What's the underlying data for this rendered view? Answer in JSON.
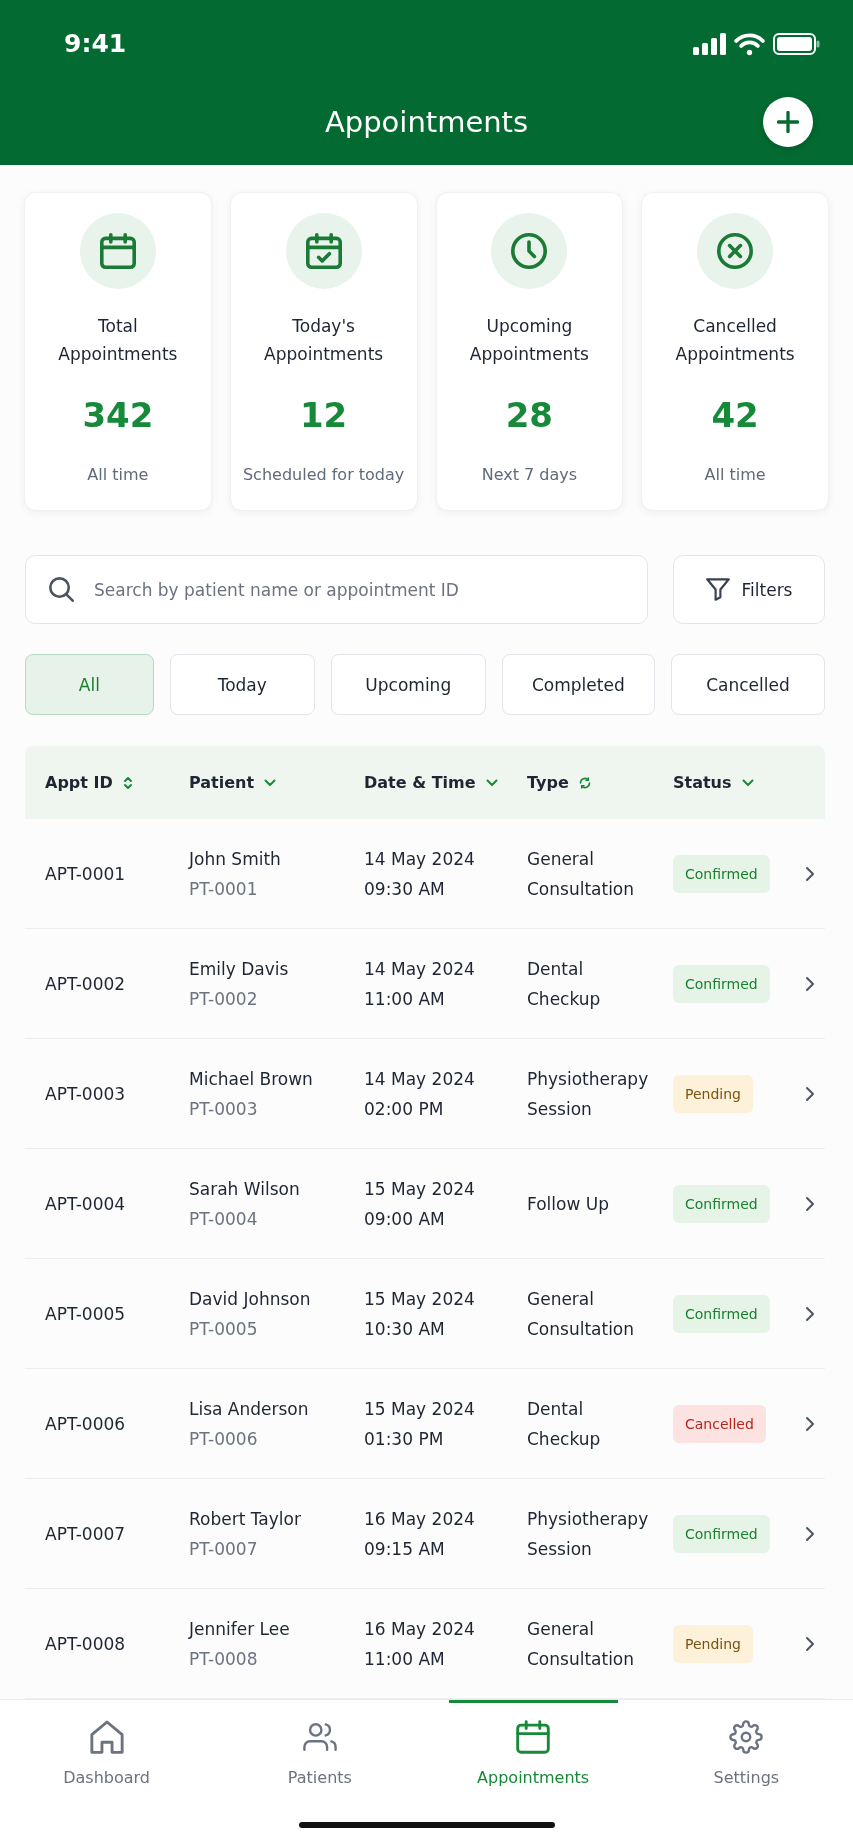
{
  "status_bar": {
    "time": "9:41"
  },
  "header": {
    "title": "Appointments"
  },
  "stats": [
    {
      "label": "Total Appointments",
      "value": "342",
      "caption": "All time"
    },
    {
      "label": "Today's Appointments",
      "value": "12",
      "caption": "Scheduled for today"
    },
    {
      "label": "Upcoming Appointments",
      "value": "28",
      "caption": "Next 7 days"
    },
    {
      "label": "Cancelled Appointments",
      "value": "42",
      "caption": "All time"
    }
  ],
  "search": {
    "placeholder": "Search by patient name or appointment ID"
  },
  "filters_button": {
    "label": "Filters"
  },
  "tabs": [
    {
      "label": "All",
      "selected": true
    },
    {
      "label": "Today",
      "selected": false
    },
    {
      "label": "Upcoming",
      "selected": false
    },
    {
      "label": "Completed",
      "selected": false
    },
    {
      "label": "Cancelled",
      "selected": false
    }
  ],
  "table": {
    "columns": [
      {
        "label": "Appt ID",
        "kind": "updown"
      },
      {
        "label": "Patient",
        "kind": "down"
      },
      {
        "label": "Date & Time",
        "kind": "down"
      },
      {
        "label": "Type",
        "kind": "cycle"
      },
      {
        "label": "Status",
        "kind": "down"
      }
    ],
    "rows": [
      {
        "id": "APT-0001",
        "patient": "John Smith",
        "patient_id": "PT-0001",
        "date": "14 May 2024",
        "time": "09:30 AM",
        "type": "General Consultation",
        "status": {
          "label": "Confirmed",
          "kind": "confirmed"
        }
      },
      {
        "id": "APT-0002",
        "patient": "Emily Davis",
        "patient_id": "PT-0002",
        "date": "14 May 2024",
        "time": "11:00 AM",
        "type": "Dental Checkup",
        "status": {
          "label": "Confirmed",
          "kind": "confirmed"
        }
      },
      {
        "id": "APT-0003",
        "patient": "Michael Brown",
        "patient_id": "PT-0003",
        "date": "14 May 2024",
        "time": "02:00 PM",
        "type": "Physiotherapy Session",
        "status": {
          "label": "Pending",
          "kind": "pending"
        }
      },
      {
        "id": "APT-0004",
        "patient": "Sarah Wilson",
        "patient_id": "PT-0004",
        "date": "15 May 2024",
        "time": "09:00 AM",
        "type": "Follow Up",
        "status": {
          "label": "Confirmed",
          "kind": "confirmed"
        }
      },
      {
        "id": "APT-0005",
        "patient": "David Johnson",
        "patient_id": "PT-0005",
        "date": "15 May 2024",
        "time": "10:30 AM",
        "type": "General Consultation",
        "status": {
          "label": "Confirmed",
          "kind": "confirmed"
        }
      },
      {
        "id": "APT-0006",
        "patient": "Lisa Anderson",
        "patient_id": "PT-0006",
        "date": "15 May 2024",
        "time": "01:30 PM",
        "type": "Dental Checkup",
        "status": {
          "label": "Cancelled",
          "kind": "cancelled"
        }
      },
      {
        "id": "APT-0007",
        "patient": "Robert Taylor",
        "patient_id": "PT-0007",
        "date": "16 May 2024",
        "time": "09:15 AM",
        "type": "Physiotherapy Session",
        "status": {
          "label": "Confirmed",
          "kind": "confirmed"
        }
      },
      {
        "id": "APT-0008",
        "patient": "Jennifer Lee",
        "patient_id": "PT-0008",
        "date": "16 May 2024",
        "time": "11:00 AM",
        "type": "General Consultation",
        "status": {
          "label": "Pending",
          "kind": "pending"
        }
      }
    ]
  },
  "bottom_nav": [
    {
      "label": "Dashboard",
      "selected": false
    },
    {
      "label": "Patients",
      "selected": false
    },
    {
      "label": "Appointments",
      "selected": true
    },
    {
      "label": "Settings",
      "selected": false
    }
  ]
}
